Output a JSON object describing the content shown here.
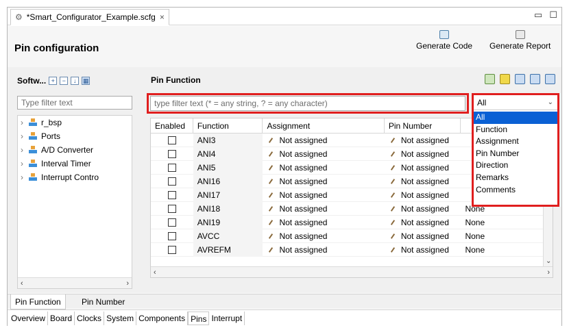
{
  "editor_tab": {
    "title": "*Smart_Configurator_Example.scfg",
    "close": "×"
  },
  "window_controls": {
    "minimize": "▭",
    "maximize": "☐"
  },
  "header": {
    "title": "Pin configuration",
    "generate_code": "Generate Code",
    "generate_report": "Generate Report"
  },
  "software_pane": {
    "title": "Softw...",
    "filter_placeholder": "Type filter text",
    "items": [
      "r_bsp",
      "Ports",
      "A/D Converter",
      "Interval Timer",
      "Interrupt Contro"
    ]
  },
  "pin_function": {
    "title": "Pin Function",
    "filter_placeholder": "type filter text (* = any string, ? = any character)",
    "filter_select": {
      "selected": "All",
      "options": [
        "All",
        "Function",
        "Assignment",
        "Pin Number",
        "Direction",
        "Remarks",
        "Comments"
      ]
    },
    "columns": [
      "Enabled",
      "Function",
      "Assignment",
      "Pin Number",
      ""
    ],
    "rows": [
      {
        "function": "ANI3",
        "assignment": "Not assigned",
        "pin_number": "Not assigned",
        "direction": ""
      },
      {
        "function": "ANI4",
        "assignment": "Not assigned",
        "pin_number": "Not assigned",
        "direction": ""
      },
      {
        "function": "ANI5",
        "assignment": "Not assigned",
        "pin_number": "Not assigned",
        "direction": ""
      },
      {
        "function": "ANI16",
        "assignment": "Not assigned",
        "pin_number": "Not assigned",
        "direction": ""
      },
      {
        "function": "ANI17",
        "assignment": "Not assigned",
        "pin_number": "Not assigned",
        "direction": ""
      },
      {
        "function": "ANI18",
        "assignment": "Not assigned",
        "pin_number": "Not assigned",
        "direction": "None"
      },
      {
        "function": "ANI19",
        "assignment": "Not assigned",
        "pin_number": "Not assigned",
        "direction": "None"
      },
      {
        "function": "AVCC",
        "assignment": "Not assigned",
        "pin_number": "Not assigned",
        "direction": "None"
      },
      {
        "function": "AVREFM",
        "assignment": "Not assigned",
        "pin_number": "Not assigned",
        "direction": "None"
      }
    ]
  },
  "sub_tabs": [
    "Pin Function",
    "Pin Number"
  ],
  "page_tabs": [
    "Overview",
    "Board",
    "Clocks",
    "System",
    "Components",
    "Pins",
    "Interrupt"
  ],
  "colors": {
    "highlight": "#e01e1e",
    "selection": "#0a60d4"
  }
}
